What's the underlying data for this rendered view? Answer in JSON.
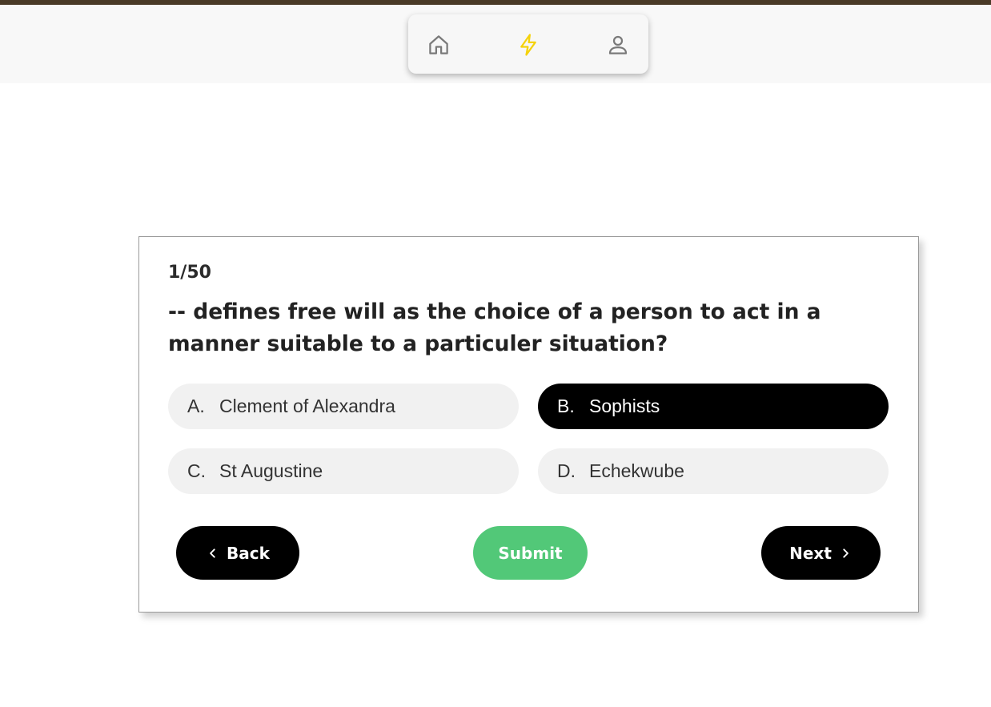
{
  "nav": {
    "items": [
      {
        "icon": "home-icon"
      },
      {
        "icon": "lightning-icon",
        "active": true,
        "color": "#f5d20a"
      },
      {
        "icon": "user-icon"
      }
    ]
  },
  "quiz": {
    "progress": "1/50",
    "question": "-- defines free will as the choice of a person to act in a manner suitable to a particuler situation?",
    "options": [
      {
        "letter": "A.",
        "text": "Clement of Alexandra",
        "selected": false
      },
      {
        "letter": "B.",
        "text": "Sophists",
        "selected": true
      },
      {
        "letter": "C.",
        "text": "St Augustine",
        "selected": false
      },
      {
        "letter": "D.",
        "text": "Echekwube",
        "selected": false
      }
    ],
    "buttons": {
      "back": "Back",
      "submit": "Submit",
      "next": "Next"
    }
  },
  "colors": {
    "top_strip": "#4a3a27",
    "selected_option": "#000000",
    "submit_button": "#52c878",
    "active_nav_icon": "#f5d20a"
  }
}
